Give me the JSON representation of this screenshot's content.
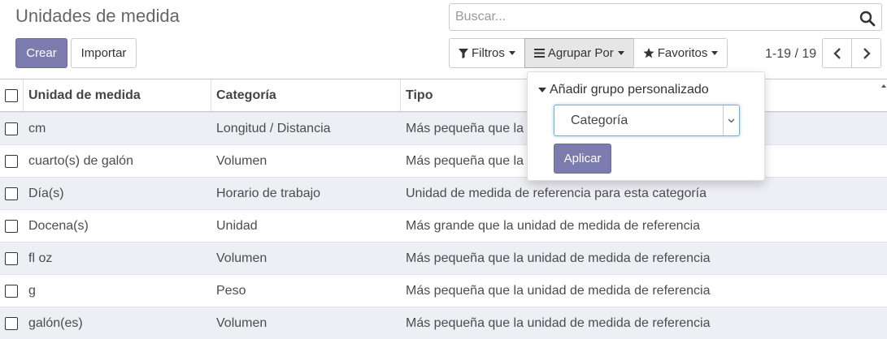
{
  "page": {
    "title": "Unidades de medida"
  },
  "buttons": {
    "create": "Crear",
    "import": "Importar"
  },
  "search": {
    "placeholder": "Buscar..."
  },
  "filters": {
    "filters": "Filtros",
    "group_by": "Agrupar Por",
    "favorites": "Favoritos"
  },
  "pager": {
    "value": "1-19 / 19"
  },
  "list": {
    "columns": [
      "Unidad de medida",
      "Categoría",
      "Tipo"
    ],
    "rows": [
      {
        "name": "cm",
        "category": "Longitud / Distancia",
        "type": "Más pequeña que la unidad de medida de referencia"
      },
      {
        "name": "cuarto(s) de galón",
        "category": "Volumen",
        "type": "Más pequeña que la unidad de medida de referencia"
      },
      {
        "name": "Día(s)",
        "category": "Horario de trabajo",
        "type": "Unidad de medida de referencia para esta categoría"
      },
      {
        "name": "Docena(s)",
        "category": "Unidad",
        "type": "Más grande que la unidad de medida de referencia"
      },
      {
        "name": "fl oz",
        "category": "Volumen",
        "type": "Más pequeña que la unidad de medida de referencia"
      },
      {
        "name": "g",
        "category": "Peso",
        "type": "Más pequeña que la unidad de medida de referencia"
      },
      {
        "name": "galón(es)",
        "category": "Volumen",
        "type": "Más pequeña que la unidad de medida de referencia"
      }
    ]
  },
  "group_dropdown": {
    "toggle_label": "Añadir grupo personalizado",
    "selected_option": "Categoría",
    "apply_label": "Aplicar"
  }
}
